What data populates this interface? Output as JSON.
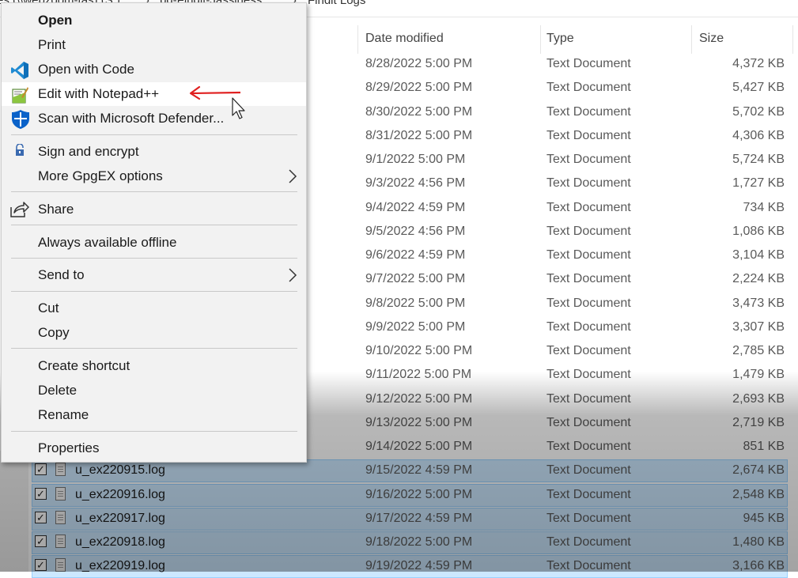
{
  "breadcrumb": {
    "parts": [
      "es (\\\\webzoom-tas) (S:)",
      "bd-Findit-Jassiness",
      "Findit Logs"
    ],
    "sep": "›"
  },
  "columns": {
    "date": "Date modified",
    "type": "Type",
    "size": "Size"
  },
  "files": [
    {
      "name": "",
      "date": "8/28/2022 5:00 PM",
      "type": "Text Document",
      "size": "4,372 KB",
      "selected": false
    },
    {
      "name": "",
      "date": "8/29/2022 5:00 PM",
      "type": "Text Document",
      "size": "5,427 KB",
      "selected": false
    },
    {
      "name": "",
      "date": "8/30/2022 5:00 PM",
      "type": "Text Document",
      "size": "5,702 KB",
      "selected": false
    },
    {
      "name": "",
      "date": "8/31/2022 5:00 PM",
      "type": "Text Document",
      "size": "4,306 KB",
      "selected": false
    },
    {
      "name": "",
      "date": "9/1/2022 5:00 PM",
      "type": "Text Document",
      "size": "5,724 KB",
      "selected": false
    },
    {
      "name": "",
      "date": "9/3/2022 4:56 PM",
      "type": "Text Document",
      "size": "1,727 KB",
      "selected": false
    },
    {
      "name": "",
      "date": "9/4/2022 4:59 PM",
      "type": "Text Document",
      "size": "734 KB",
      "selected": false
    },
    {
      "name": "",
      "date": "9/5/2022 4:56 PM",
      "type": "Text Document",
      "size": "1,086 KB",
      "selected": false
    },
    {
      "name": "",
      "date": "9/6/2022 4:59 PM",
      "type": "Text Document",
      "size": "3,104 KB",
      "selected": false
    },
    {
      "name": "",
      "date": "9/7/2022 5:00 PM",
      "type": "Text Document",
      "size": "2,224 KB",
      "selected": false
    },
    {
      "name": "",
      "date": "9/8/2022 5:00 PM",
      "type": "Text Document",
      "size": "3,473 KB",
      "selected": false
    },
    {
      "name": "",
      "date": "9/9/2022 5:00 PM",
      "type": "Text Document",
      "size": "3,307 KB",
      "selected": false
    },
    {
      "name": "",
      "date": "9/10/2022 5:00 PM",
      "type": "Text Document",
      "size": "2,785 KB",
      "selected": false
    },
    {
      "name": "",
      "date": "9/11/2022 5:00 PM",
      "type": "Text Document",
      "size": "1,479 KB",
      "selected": false
    },
    {
      "name": "",
      "date": "9/12/2022 5:00 PM",
      "type": "Text Document",
      "size": "2,693 KB",
      "selected": false
    },
    {
      "name": "",
      "date": "9/13/2022 5:00 PM",
      "type": "Text Document",
      "size": "2,719 KB",
      "selected": false
    },
    {
      "name": "",
      "date": "9/14/2022 5:00 PM",
      "type": "Text Document",
      "size": "851 KB",
      "selected": false
    },
    {
      "name": "u_ex220915.log",
      "date": "9/15/2022 4:59 PM",
      "type": "Text Document",
      "size": "2,674 KB",
      "selected": true
    },
    {
      "name": "u_ex220916.log",
      "date": "9/16/2022 5:00 PM",
      "type": "Text Document",
      "size": "2,548 KB",
      "selected": true
    },
    {
      "name": "u_ex220917.log",
      "date": "9/17/2022 4:59 PM",
      "type": "Text Document",
      "size": "945 KB",
      "selected": true
    },
    {
      "name": "u_ex220918.log",
      "date": "9/18/2022 5:00 PM",
      "type": "Text Document",
      "size": "1,480 KB",
      "selected": true
    },
    {
      "name": "u_ex220919.log",
      "date": "9/19/2022 4:59 PM",
      "type": "Text Document",
      "size": "3,166 KB",
      "selected": true
    }
  ],
  "check_glyph": "✓",
  "context_menu": {
    "open": "Open",
    "print": "Print",
    "open_with_code": "Open with Code",
    "edit_notepad": "Edit with Notepad++",
    "scan_defender": "Scan with Microsoft Defender...",
    "sign_encrypt": "Sign and encrypt",
    "gpgex_options": "More GpgEX options",
    "share": "Share",
    "always_offline": "Always available offline",
    "send_to": "Send to",
    "cut": "Cut",
    "copy": "Copy",
    "create_shortcut": "Create shortcut",
    "delete": "Delete",
    "rename": "Rename",
    "properties": "Properties"
  },
  "icons": {
    "vscode": "vscode-icon",
    "notepadpp": "notepad-plus-plus-icon",
    "defender": "defender-shield-icon",
    "lock": "lock-icon",
    "share": "share-icon"
  },
  "colors": {
    "selection": "#cce8ff",
    "annotation_arrow": "#e02020",
    "vscode_blue": "#1f8ad2",
    "defender_blue": "#0a62c9"
  }
}
